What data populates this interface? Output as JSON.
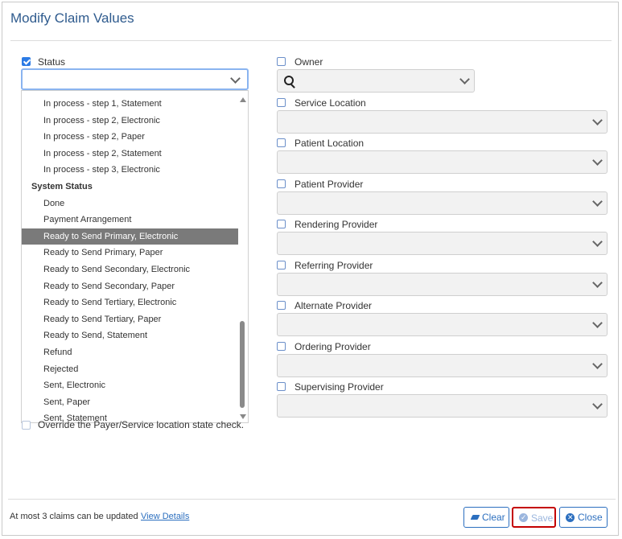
{
  "dialog": {
    "title": "Modify Claim Values"
  },
  "status": {
    "label": "Status",
    "checked": true,
    "value": ""
  },
  "status_dropdown": {
    "options": [
      {
        "label": "In process - step 1, Statement",
        "type": "option"
      },
      {
        "label": "In process - step 2, Electronic",
        "type": "option"
      },
      {
        "label": "In process - step 2, Paper",
        "type": "option"
      },
      {
        "label": "In process - step 2, Statement",
        "type": "option"
      },
      {
        "label": "In process - step 3, Electronic",
        "type": "option"
      },
      {
        "label": "System Status",
        "type": "group"
      },
      {
        "label": "Done",
        "type": "option"
      },
      {
        "label": "Payment Arrangement",
        "type": "option"
      },
      {
        "label": "Ready to Send Primary, Electronic",
        "type": "option",
        "selected": true
      },
      {
        "label": "Ready to Send Primary, Paper",
        "type": "option"
      },
      {
        "label": "Ready to Send Secondary, Electronic",
        "type": "option"
      },
      {
        "label": "Ready to Send Secondary, Paper",
        "type": "option"
      },
      {
        "label": "Ready to Send Tertiary, Electronic",
        "type": "option"
      },
      {
        "label": "Ready to Send Tertiary, Paper",
        "type": "option"
      },
      {
        "label": "Ready to Send, Statement",
        "type": "option"
      },
      {
        "label": "Refund",
        "type": "option"
      },
      {
        "label": "Rejected",
        "type": "option"
      },
      {
        "label": "Sent, Electronic",
        "type": "option"
      },
      {
        "label": "Sent, Paper",
        "type": "option"
      },
      {
        "label": "Sent, Statement",
        "type": "option"
      }
    ]
  },
  "override": {
    "label": "Override the Payer/Service location state check."
  },
  "right_fields": [
    {
      "label": "Owner",
      "kind": "search-select"
    },
    {
      "label": "Service Location",
      "kind": "select"
    },
    {
      "label": "Patient Location",
      "kind": "select"
    },
    {
      "label": "Patient Provider",
      "kind": "select"
    },
    {
      "label": "Rendering Provider",
      "kind": "select"
    },
    {
      "label": "Referring Provider",
      "kind": "select"
    },
    {
      "label": "Alternate Provider",
      "kind": "select"
    },
    {
      "label": "Ordering Provider",
      "kind": "select"
    },
    {
      "label": "Supervising Provider",
      "kind": "select"
    }
  ],
  "footer": {
    "note": "At most 3 claims can be updated",
    "details_link": "View Details",
    "clear_label": "Clear",
    "save_label": "Save",
    "close_label": "Close"
  },
  "colors": {
    "accent": "#2c6fbf",
    "title": "#2f5b8e",
    "selected_row": "#7a7a7a",
    "highlight_border": "#c40000"
  }
}
